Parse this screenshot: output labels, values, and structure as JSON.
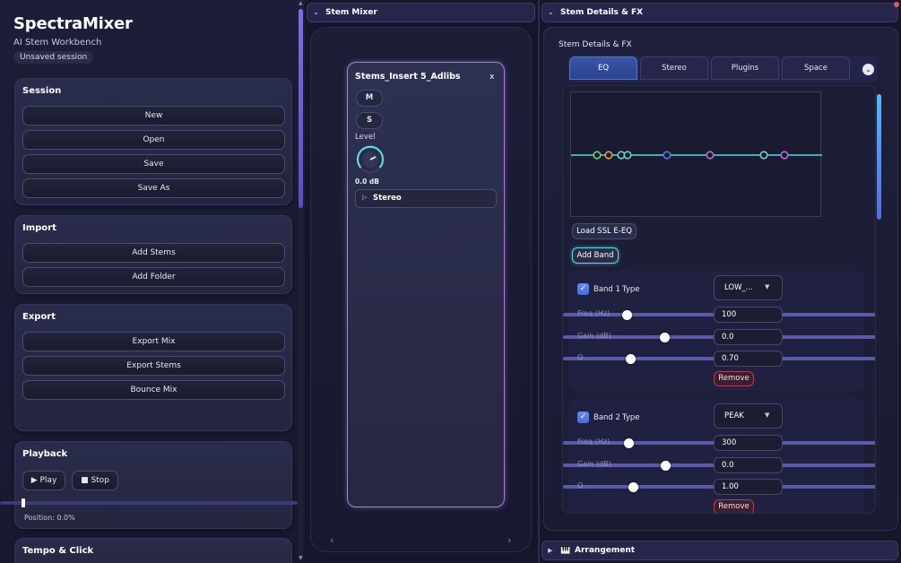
{
  "app": {
    "title": "SpectraMixer",
    "subtitle": "AI Stem Workbench",
    "session_status": "Unsaved session"
  },
  "session": {
    "title": "Session",
    "buttons": [
      "New",
      "Open",
      "Save",
      "Save As"
    ]
  },
  "import": {
    "title": "Import",
    "buttons": [
      "Add Stems",
      "Add Folder"
    ]
  },
  "export": {
    "title": "Export",
    "buttons": [
      "Export Mix",
      "Export Stems",
      "Bounce Mix"
    ]
  },
  "playback": {
    "title": "Playback",
    "play_label": "▶ Play",
    "stop_label": "■ Stop",
    "position_text": "Position: 0.0%",
    "position_fraction": 0.0
  },
  "tempo": {
    "title": "Tempo & Click"
  },
  "stem_mixer": {
    "panel_title": "Stem Mixer",
    "strip": {
      "name": "Stems_Insert 5_Adlibs",
      "close_label": "x",
      "mute_label": "M",
      "solo_label": "S",
      "level_label": "Level",
      "level_value": "0.0 dB",
      "stereo_label": "Stereo"
    },
    "nav_prev": "‹",
    "nav_next": "›"
  },
  "details": {
    "panel_title": "Stem Details & FX",
    "section_title": "Stem Details & FX",
    "tabs": [
      "EQ",
      "Stereo",
      "Plugins",
      "Space"
    ],
    "active_tab": "EQ",
    "load_preset_label": "Load SSL E-EQ",
    "add_band_label": "Add Band",
    "bands": [
      {
        "label": "Band 1",
        "type_label": "Type",
        "type_value": "LOW_...",
        "enabled": true,
        "freq_label": "Freq (Hz)",
        "freq_value": "100",
        "gain_label": "Gain (dB)",
        "gain_value": "0.0",
        "q_label": "Q",
        "q_value": "0.70",
        "remove_label": "Remove"
      },
      {
        "label": "Band 2",
        "type_label": "Type",
        "type_value": "PEAK",
        "enabled": true,
        "freq_label": "Freq (Hz)",
        "freq_value": "300",
        "gain_label": "Gain (dB)",
        "gain_value": "0.0",
        "q_label": "Q",
        "q_value": "1.00",
        "remove_label": "Remove"
      }
    ],
    "eq_points_colors": [
      "#6fd07a",
      "#e0a050",
      "#6fd0c8",
      "#6fd0c8",
      "#6070e0",
      "#b070d8",
      "#6fd0c8",
      "#b070d8"
    ]
  },
  "arrangement": {
    "panel_title": "Arrangement"
  },
  "colors": {
    "accent": "#7c6cf0",
    "cyan": "#5ad8e8",
    "track": "#5a5ba8"
  }
}
